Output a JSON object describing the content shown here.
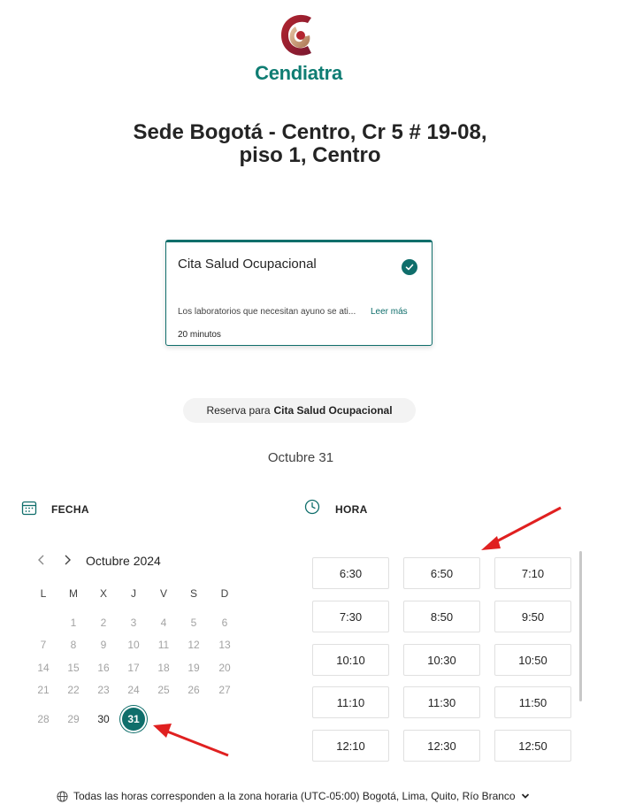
{
  "brand": {
    "name": "Cendiatra"
  },
  "page": {
    "title": "Sede Bogotá - Centro, Cr 5 # 19-08, piso 1, Centro"
  },
  "service_card": {
    "name": "Cita Salud Ocupacional",
    "description": "Los laboratorios que necesitan ayuno se ati...",
    "read_more": "Leer más",
    "duration": "20 minutos"
  },
  "booking": {
    "prefix": "Reserva para",
    "service": "Cita Salud Ocupacional"
  },
  "selected_date": "Octubre 31",
  "date_section": {
    "label": "FECHA",
    "icon": "calendar-icon"
  },
  "time_section": {
    "label": "HORA",
    "icon": "clock-icon"
  },
  "calendar": {
    "month": "Octubre 2024",
    "weekdays": [
      "L",
      "M",
      "X",
      "J",
      "V",
      "S",
      "D"
    ],
    "weeks": [
      [
        "",
        "1",
        "2",
        "3",
        "4",
        "5",
        "6"
      ],
      [
        "7",
        "8",
        "9",
        "10",
        "11",
        "12",
        "13"
      ],
      [
        "14",
        "15",
        "16",
        "17",
        "18",
        "19",
        "20"
      ],
      [
        "21",
        "22",
        "23",
        "24",
        "25",
        "26",
        "27"
      ],
      [
        "28",
        "29",
        "30",
        "31",
        "",
        "",
        ""
      ]
    ],
    "available_days": [
      "30",
      "31"
    ],
    "selected_day": "31"
  },
  "time_slots": [
    "6:30",
    "6:50",
    "7:10",
    "7:30",
    "8:50",
    "9:50",
    "10:10",
    "10:30",
    "10:50",
    "11:10",
    "11:30",
    "11:50",
    "12:10",
    "12:30",
    "12:50"
  ],
  "timezone": {
    "text": "Todas las horas corresponden a la zona horaria  (UTC-05:00) Bogotá, Lima, Quito, Río Branco"
  },
  "colors": {
    "accent": "#0f6e6b",
    "brand_teal": "#0f7d73",
    "annotation_red": "#e02020"
  }
}
